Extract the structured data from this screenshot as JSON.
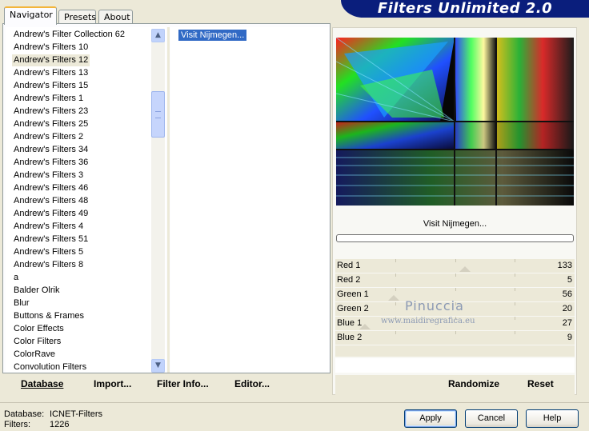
{
  "banner": {
    "title": "Filters Unlimited 2.0"
  },
  "tabs": [
    {
      "label": "Navigator",
      "active": true
    },
    {
      "label": "Presets",
      "active": false
    },
    {
      "label": "About",
      "active": false
    }
  ],
  "filter_list": {
    "items": [
      "Andrew's Filter Collection 62",
      "Andrew's Filters 10",
      "Andrew's Filters 12",
      "Andrew's Filters 13",
      "Andrew's Filters 15",
      "Andrew's Filters 1",
      "Andrew's Filters 23",
      "Andrew's Filters 25",
      "Andrew's Filters 2",
      "Andrew's Filters 34",
      "Andrew's Filters 36",
      "Andrew's Filters 3",
      "Andrew's Filters 46",
      "Andrew's Filters 48",
      "Andrew's Filters 49",
      "Andrew's Filters 4",
      "Andrew's Filters 51",
      "Andrew's Filters 5",
      "Andrew's Filters 8",
      "a",
      "Balder Olrik",
      "Blur",
      "Buttons & Frames",
      "Color Effects",
      "Color Filters",
      "ColorRave",
      "Convolution Filters"
    ],
    "selected_index": 2
  },
  "effect_list": {
    "selected": "Visit Nijmegen..."
  },
  "actions_left": {
    "database": "Database",
    "import": "Import...",
    "filter_info": "Filter Info...",
    "editor": "Editor..."
  },
  "preview": {
    "filter_name": "Visit Nijmegen..."
  },
  "sliders": [
    {
      "label": "Red 1",
      "value": "133",
      "level": 0.52
    },
    {
      "label": "Red 2",
      "value": "5",
      "level": null
    },
    {
      "label": "Green 1",
      "value": "56",
      "level": 0.22
    },
    {
      "label": "Green 2",
      "value": "20",
      "level": null
    },
    {
      "label": "Blue 1",
      "value": "27",
      "level": 0.1
    },
    {
      "label": "Blue 2",
      "value": "9",
      "level": null
    }
  ],
  "actions_right": {
    "randomize": "Randomize",
    "reset": "Reset"
  },
  "status": {
    "database_label": "Database:",
    "database_value": "ICNET-Filters",
    "filters_label": "Filters:",
    "filters_value": "1226"
  },
  "buttons": {
    "apply": "Apply",
    "cancel": "Cancel",
    "help": "Help"
  },
  "watermark": {
    "name": "Pinuccia",
    "url": "www.maidiregrafica.eu"
  }
}
